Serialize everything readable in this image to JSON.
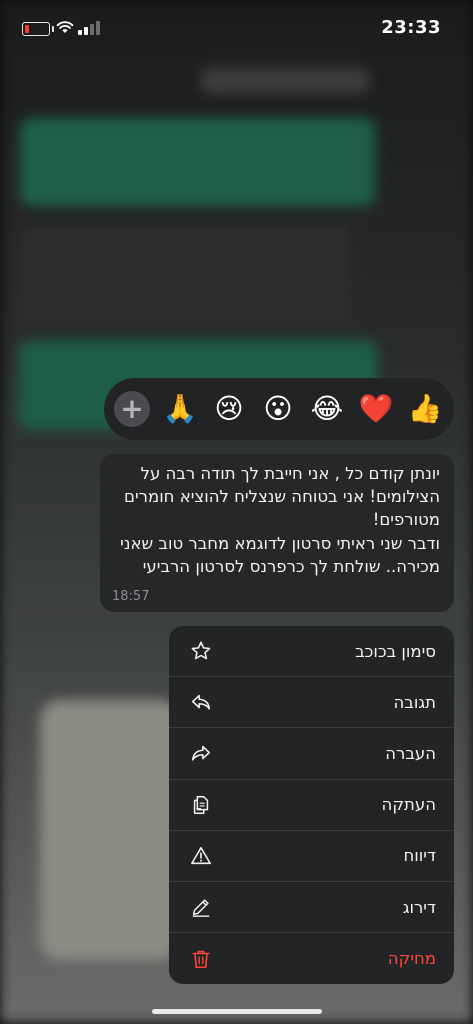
{
  "status_bar": {
    "time": "23:33",
    "battery_level": 0.1,
    "battery_color": "#ff3b30"
  },
  "reactions": {
    "items": [
      {
        "name": "thumbs-up",
        "emoji": "👍"
      },
      {
        "name": "red-heart",
        "emoji": "❤️"
      },
      {
        "name": "tears-of-joy",
        "emoji": "😂"
      },
      {
        "name": "surprised",
        "emoji": "😮"
      },
      {
        "name": "crying",
        "emoji": "😢"
      },
      {
        "name": "folded-hands",
        "emoji": "🙏"
      }
    ],
    "more_icon": "plus-icon"
  },
  "message": {
    "text": "יונתן קודם כל , אני חייבת לך תודה רבה על הצילומים! אני בטוחה שנצליח להוציא חומרים מטורפים!\nודבר שני ראיתי סרטון לדוגמא מחבר טוב שאני מכירה.. שולחת לך כרפרנס לסרטון הרביעי",
    "time": "18:57"
  },
  "menu": {
    "star": {
      "label": "סימון בכוכב",
      "icon": "star-icon"
    },
    "reply": {
      "label": "תגובה",
      "icon": "reply-icon"
    },
    "forward": {
      "label": "העברה",
      "icon": "forward-icon"
    },
    "copy": {
      "label": "העתקה",
      "icon": "copy-icon"
    },
    "report": {
      "label": "דיווח",
      "icon": "warning-icon"
    },
    "rate": {
      "label": "דירוג",
      "icon": "pencil-icon"
    },
    "delete": {
      "label": "מחיקה",
      "icon": "trash-icon",
      "color": "#ff453a"
    }
  }
}
